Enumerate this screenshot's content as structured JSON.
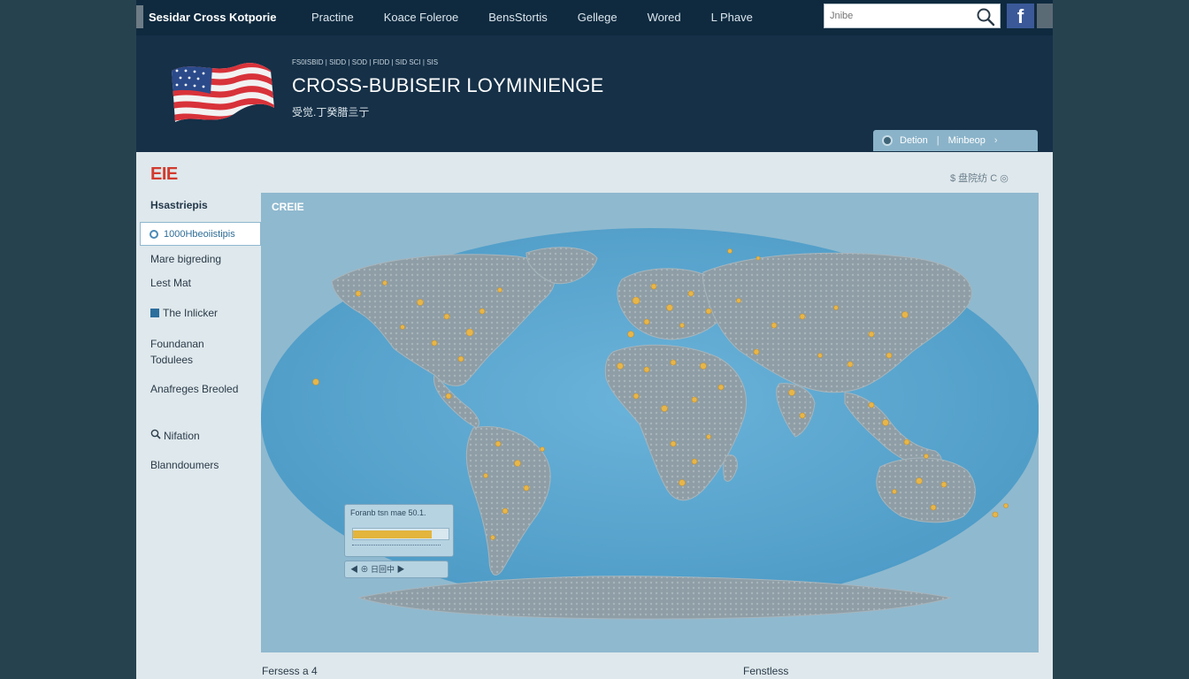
{
  "nav": {
    "brand": "Sesidar Cross Kotporie",
    "links": [
      "Practine",
      "Koace Foleroe",
      "BensStortis",
      "Gellege",
      "Wored",
      "L Phave"
    ],
    "search_placeholder": "Jnibe",
    "facebook_label": "f"
  },
  "banner": {
    "breadcrumb": "FS0ISBID | SIDD | SOD | FIDD | SID SCI | SIS",
    "title": "CROSS-BUBISEIR LOYMINIENGE",
    "subtitle": "受觉.丁癸腊亖亍",
    "pill": [
      "Detion",
      "Minbeop"
    ]
  },
  "sidebar": {
    "logo": "EIE",
    "heading": "Hsastriepis",
    "active_item": "1000Hbeoiistipis",
    "items": [
      {
        "label": "Mare bigreding",
        "icon": ""
      },
      {
        "label": "Lest Mat",
        "icon": ""
      },
      {
        "label": "The Inlicker",
        "icon": "square-icon"
      },
      {
        "label": "Foundanan Todulees",
        "icon": ""
      },
      {
        "label": "Anafreges Breoled",
        "icon": ""
      },
      {
        "label": "Nifation",
        "icon": "magnifier-icon"
      },
      {
        "label": "Blanndoumers",
        "icon": ""
      }
    ]
  },
  "panel": {
    "title": "CREIE",
    "tools": "$ 盘院纺  C ◎",
    "legend_title": "Foranb tsn mae 50.1.",
    "legend_fill": 0.82,
    "legend_caption": "◀ ⊕ 日回中 ▶"
  },
  "footer": {
    "left": "Fersess a 4",
    "right": "Fenstless"
  },
  "colors": {
    "nav_bg": "#0f2a3f",
    "banner_bg": "#153047",
    "ocean": "#5ea8d1",
    "land": "#8b9ba3",
    "dot": "#e7b64a",
    "accent_red": "#d23a2e"
  }
}
